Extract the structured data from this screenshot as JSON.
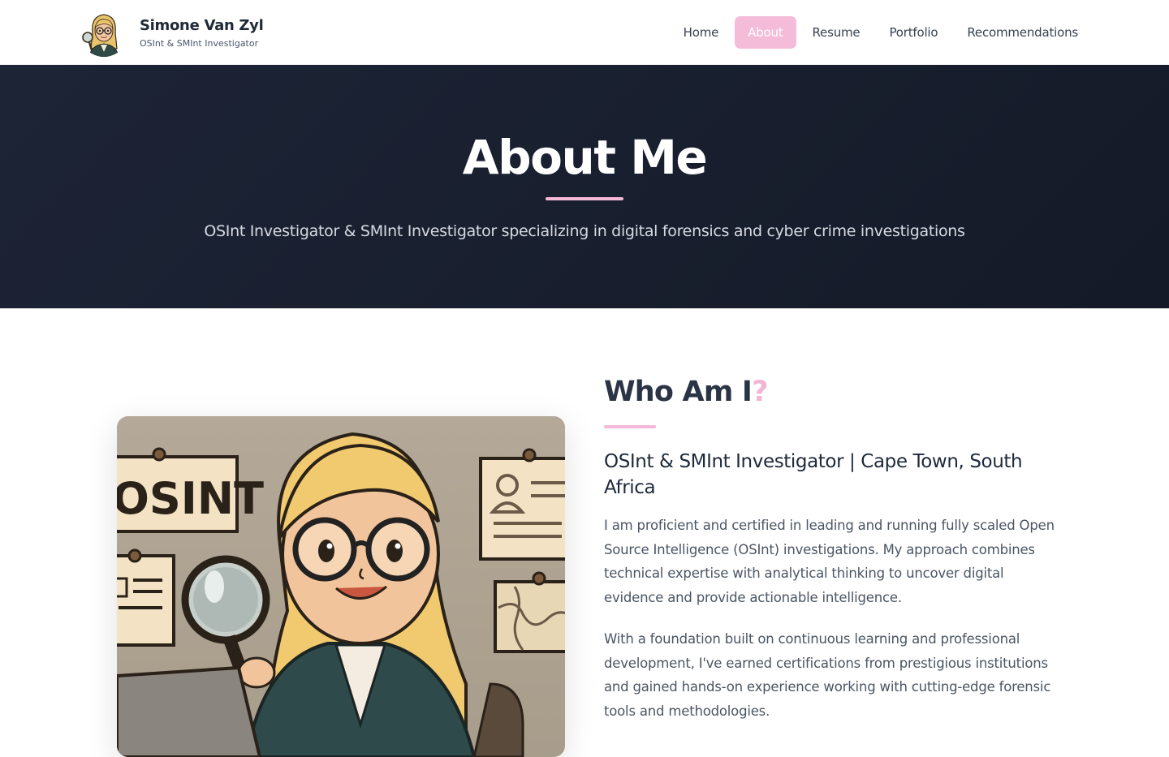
{
  "brand": {
    "name": "Simone Van Zyl",
    "subtitle": "OSInt & SMInt Investigator"
  },
  "nav": {
    "items": [
      {
        "label": "Home",
        "active": false
      },
      {
        "label": "About",
        "active": true
      },
      {
        "label": "Resume",
        "active": false
      },
      {
        "label": "Portfolio",
        "active": false
      },
      {
        "label": "Recommendations",
        "active": false
      }
    ]
  },
  "hero": {
    "title": "About Me",
    "subtitle": "OSInt Investigator & SMInt Investigator specializing in digital forensics and cyber crime investigations"
  },
  "about": {
    "title_main": "Who Am I",
    "title_accent": "?",
    "role": "OSInt & SMInt Investigator | Cape Town, South Africa",
    "paragraphs": [
      "I am proficient and certified in leading and running fully scaled Open Source Intelligence (OSInt) investigations. My approach combines technical expertise with analytical thinking to uncover digital evidence and provide actionable intelligence.",
      "With a foundation built on continuous learning and professional development, I've earned certifications from prestigious institutions and gained hands-on experience working with cutting-edge forensic tools and methodologies."
    ],
    "portrait_sign_text": "OSINT"
  },
  "colors": {
    "accent_pink": "#f4b9d6",
    "hero_bg": "#1a2131",
    "heading": "#2b3445",
    "body_text": "#4b5563"
  }
}
